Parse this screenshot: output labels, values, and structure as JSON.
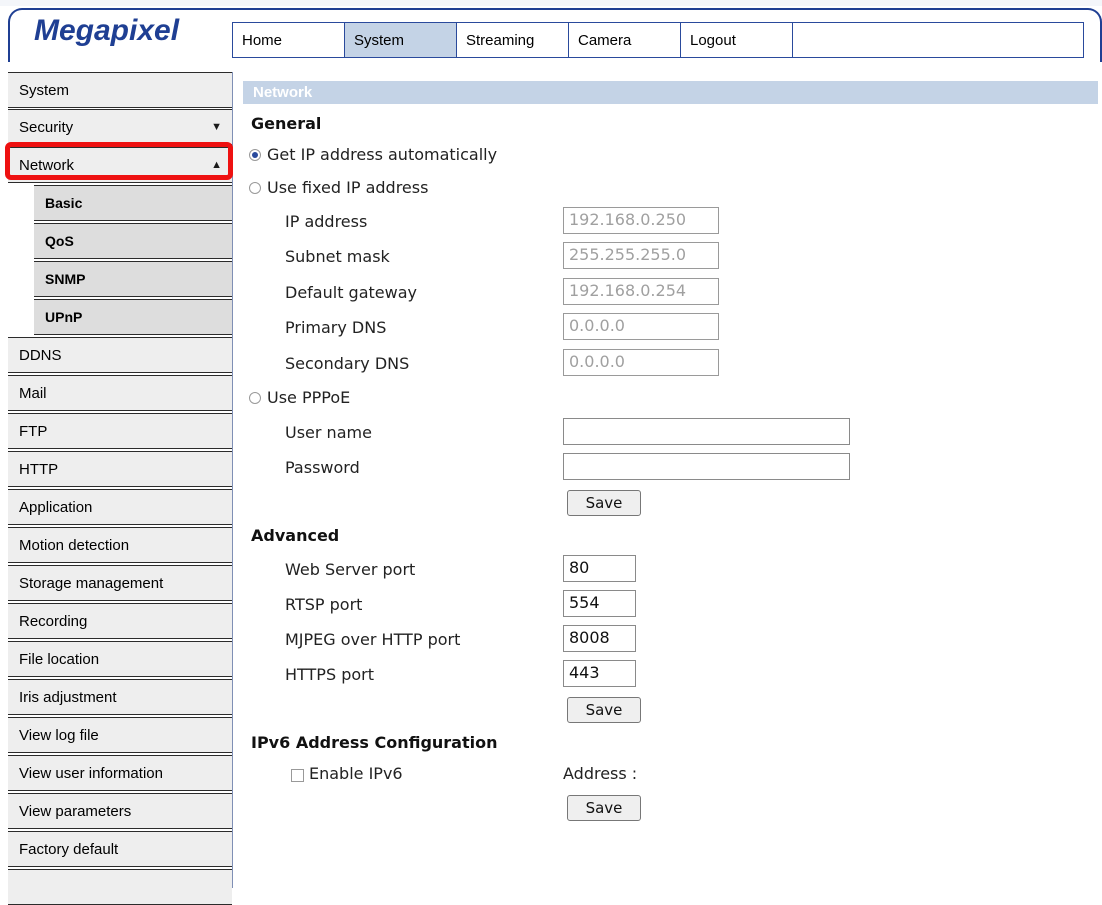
{
  "header": {
    "logo": "Megapixel",
    "tabs": [
      "Home",
      "System",
      "Streaming",
      "Camera",
      "Logout"
    ],
    "active_tab": "System"
  },
  "sidebar": {
    "items": [
      {
        "label": "System"
      },
      {
        "label": "Security",
        "arrow": "▼"
      },
      {
        "label": "Network",
        "arrow": "▲"
      },
      {
        "label": "Basic"
      },
      {
        "label": "QoS"
      },
      {
        "label": "SNMP"
      },
      {
        "label": "UPnP"
      },
      {
        "label": "DDNS"
      },
      {
        "label": "Mail"
      },
      {
        "label": "FTP"
      },
      {
        "label": "HTTP"
      },
      {
        "label": "Application"
      },
      {
        "label": "Motion detection"
      },
      {
        "label": "Storage management"
      },
      {
        "label": "Recording"
      },
      {
        "label": "File location"
      },
      {
        "label": "Iris adjustment"
      },
      {
        "label": "View log file"
      },
      {
        "label": "View user information"
      },
      {
        "label": "View parameters"
      },
      {
        "label": "Factory default"
      }
    ]
  },
  "content": {
    "section_title": "Network",
    "general": {
      "heading": "General",
      "options": {
        "auto": "Get IP address automatically",
        "fixed": "Use fixed IP address",
        "pppoe": "Use PPPoE"
      },
      "selected": "auto",
      "fixed_fields": {
        "ip_label": "IP address",
        "ip_value": "192.168.0.250",
        "mask_label": "Subnet mask",
        "mask_value": "255.255.255.0",
        "gw_label": "Default gateway",
        "gw_value": "192.168.0.254",
        "dns1_label": "Primary DNS",
        "dns1_value": "0.0.0.0",
        "dns2_label": "Secondary DNS",
        "dns2_value": "0.0.0.0"
      },
      "pppoe_fields": {
        "user_label": "User name",
        "user_value": "",
        "pass_label": "Password",
        "pass_value": ""
      },
      "save_label": "Save"
    },
    "advanced": {
      "heading": "Advanced",
      "web_label": "Web Server port",
      "web_value": "80",
      "rtsp_label": "RTSP port",
      "rtsp_value": "554",
      "mjpeg_label": "MJPEG over HTTP port",
      "mjpeg_value": "8008",
      "https_label": "HTTPS port",
      "https_value": "443",
      "save_label": "Save"
    },
    "ipv6": {
      "heading": "IPv6 Address Configuration",
      "enable_label": "Enable IPv6",
      "enabled": false,
      "address_label": "Address :",
      "save_label": "Save"
    }
  }
}
